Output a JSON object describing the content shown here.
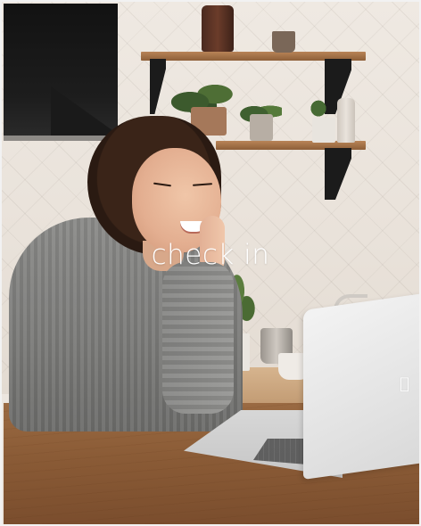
{
  "overlay": {
    "caption": "check in"
  },
  "icons": {
    "laptop_logo": "apple-logo-icon"
  },
  "colors": {
    "caption_text": "#ffffff",
    "sweater": "#7f7f7d",
    "desk": "#8a5b36",
    "wall": "#ece6df"
  }
}
